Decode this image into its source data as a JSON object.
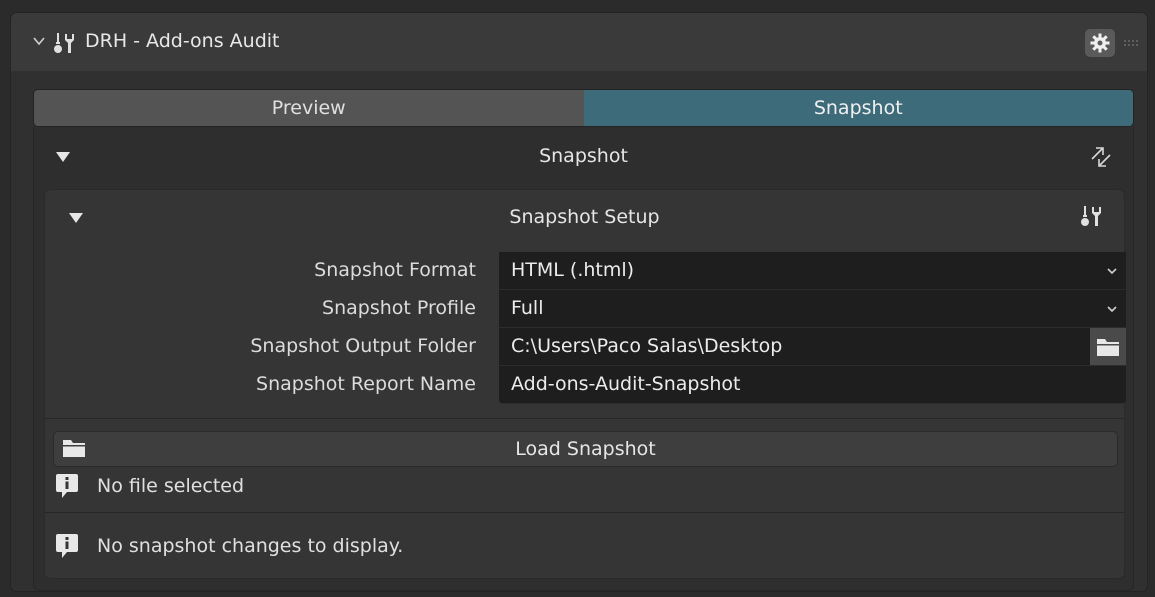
{
  "header": {
    "title": "DRH - Add-ons Audit",
    "icons": [
      "chevron-down-icon",
      "tool-icon",
      "gear-icon",
      "grip-icon"
    ]
  },
  "tabs": [
    {
      "label": "Preview",
      "active": false
    },
    {
      "label": "Snapshot",
      "active": true
    }
  ],
  "colors": {
    "active_tab": "#3d6b7a",
    "panel": "#303030",
    "field": "#1e1e1e"
  },
  "snapshot_section": {
    "title": "Snapshot"
  },
  "setup_section": {
    "title": "Snapshot Setup",
    "fields": [
      {
        "label": "Snapshot Format",
        "value": "HTML (.html)"
      },
      {
        "label": "Snapshot Profile",
        "value": "Full"
      },
      {
        "label": "Snapshot Output Folder",
        "value": "C:\\Users\\Paco Salas\\Desktop"
      },
      {
        "label": "Snapshot Report Name",
        "value": "Add-ons-Audit-Snapshot"
      }
    ]
  },
  "load_button": {
    "label": "Load Snapshot"
  },
  "messages": {
    "file_status": "No file selected",
    "changes_status": "No snapshot changes to display."
  }
}
